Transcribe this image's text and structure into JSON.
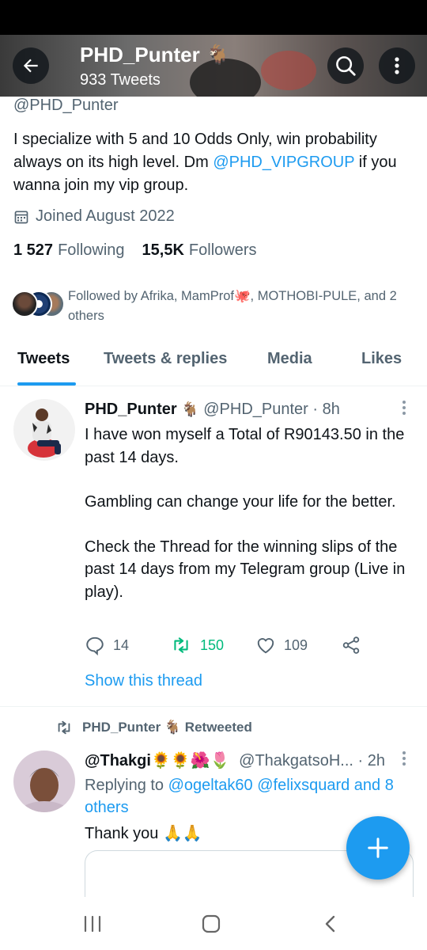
{
  "header": {
    "title": "PHD_Punter",
    "title_emoji": "🐐",
    "subtitle": "933 Tweets"
  },
  "profile": {
    "handle": "@PHD_Punter",
    "bio_part1": "I specialize with 5 and 10 Odds Only, win probability always on its high level. Dm ",
    "bio_link": "@PHD_VIPGROUP",
    "bio_part2": " if you wanna join my vip group.",
    "joined": "Joined August 2022",
    "following_count": "1 527",
    "following_label": "Following",
    "followers_count": "15,5K",
    "followers_label": "Followers",
    "followed_by": "Followed by Afrika, MamProf🐙, MOTHOBI-PULE, and 2 others"
  },
  "tabs": [
    {
      "label": "Tweets",
      "active": true
    },
    {
      "label": "Tweets & replies"
    },
    {
      "label": "Media"
    },
    {
      "label": "Likes"
    }
  ],
  "tweet1": {
    "name": "PHD_Punter",
    "emoji": "🐐",
    "handle_time": "@PHD_Punter · 8h",
    "body_p1": "I have won myself a Total of R90143.50 in the past 14 days.",
    "body_p2": "Gambling can change your life for the better.",
    "body_p3": "Check the Thread for the winning slips of the past 14 days from my Telegram group (Live in play).",
    "replies": "14",
    "retweets": "150",
    "likes": "109",
    "show_thread": "Show this thread"
  },
  "tweet2": {
    "retweeted_by": "PHD_Punter 🐐 Retweeted",
    "name": "@Thakgi🌻🌻🌺🌷",
    "handle_time": "@ThakgatsoH... · 2h",
    "replying_prefix": "Replying to ",
    "replying_links": "@ogeltak60 @felixsquard and 8 others",
    "body": "Thank you 🙏🙏"
  },
  "colors": {
    "accent": "#1d9bf0",
    "retweet_green": "#00ba7c",
    "secondary_text": "#536471"
  },
  "icons": [
    "back-arrow-icon",
    "search-icon",
    "more-vertical-icon",
    "calendar-icon",
    "reply-icon",
    "retweet-icon",
    "like-icon",
    "share-icon",
    "compose-plus-icon",
    "nav-recents-icon",
    "nav-home-icon",
    "nav-back-icon"
  ]
}
